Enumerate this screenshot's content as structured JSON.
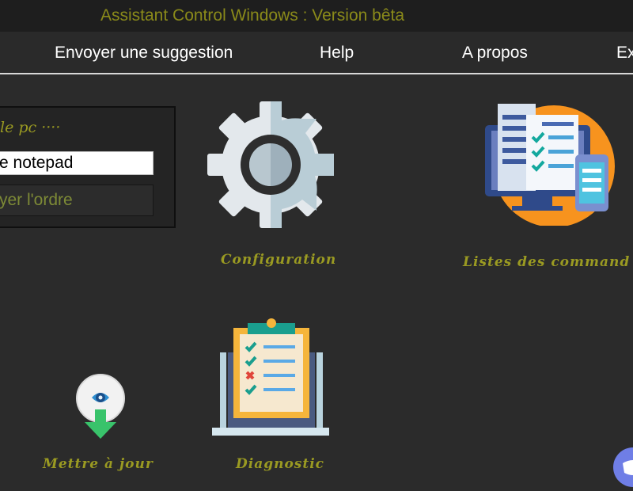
{
  "window": {
    "title": "Assistant Control Windows : Version bêta"
  },
  "menu": {
    "items": [
      "Envoyer une suggestion",
      "Help",
      "A propos",
      "Ex"
    ]
  },
  "command_panel": {
    "label": "le pc ····",
    "input_value": "e notepad",
    "send_label": "yer l'ordre"
  },
  "tiles": {
    "config": {
      "label": "Configuration",
      "icon": "gear-icon"
    },
    "commands": {
      "label": "Listes des command",
      "icon": "command-list-icon"
    },
    "update": {
      "label": "Mettre à jour",
      "icon": "update-download-icon"
    },
    "diagnostic": {
      "label": "Diagnostic",
      "icon": "clipboard-checklist-icon"
    }
  },
  "colors": {
    "background": "#2b2b2b",
    "titlebar": "#1e1e1e",
    "title_text": "#8a8a1a",
    "label_text": "#9a9a22",
    "button_text": "#7d8a36"
  }
}
